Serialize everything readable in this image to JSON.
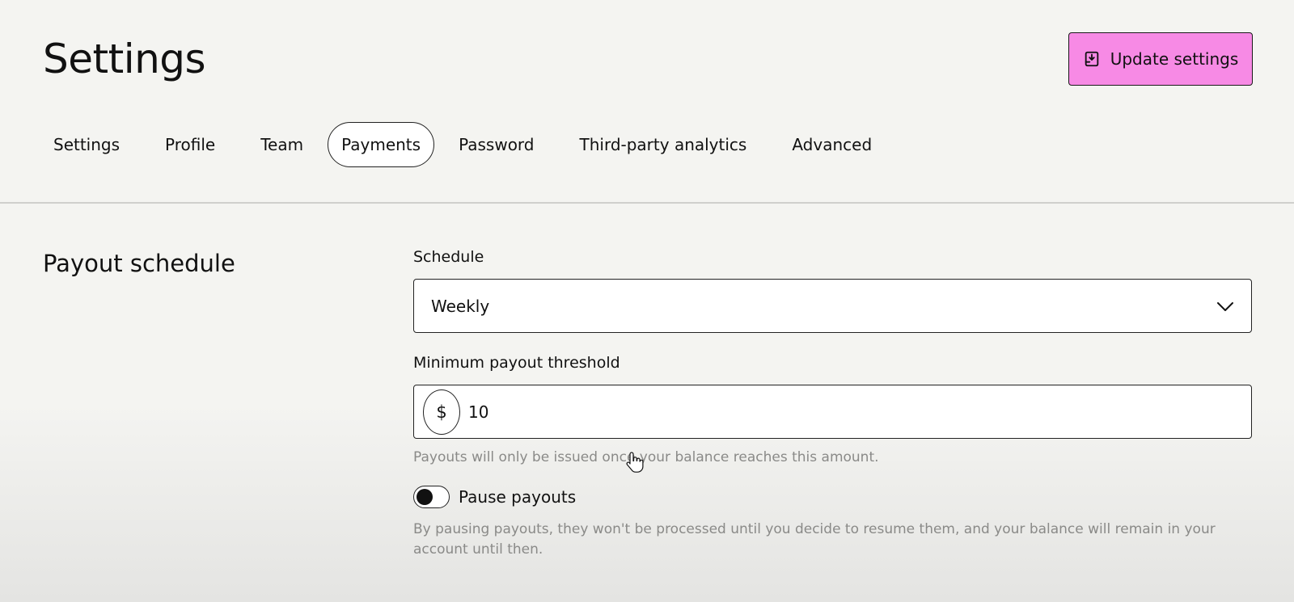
{
  "header": {
    "title": "Settings",
    "update_button_label": "Update settings",
    "update_button_color": "#f78ae5",
    "update_button_icon": "save-icon"
  },
  "tabs": [
    {
      "label": "Settings",
      "active": false
    },
    {
      "label": "Profile",
      "active": false
    },
    {
      "label": "Team",
      "active": false
    },
    {
      "label": "Payments",
      "active": true
    },
    {
      "label": "Password",
      "active": false
    },
    {
      "label": "Third-party analytics",
      "active": false
    },
    {
      "label": "Advanced",
      "active": false
    }
  ],
  "payout": {
    "section_title": "Payout schedule",
    "schedule_label": "Schedule",
    "schedule_value": "Weekly",
    "threshold_label": "Minimum payout threshold",
    "currency_symbol": "$",
    "threshold_value": "10",
    "threshold_hint": "Payouts will only be issued once your balance reaches this amount.",
    "pause_label": "Pause payouts",
    "pause_enabled": false,
    "pause_hint": "By pausing payouts, they won't be processed until you decide to resume them, and your balance will remain in your account until then."
  }
}
